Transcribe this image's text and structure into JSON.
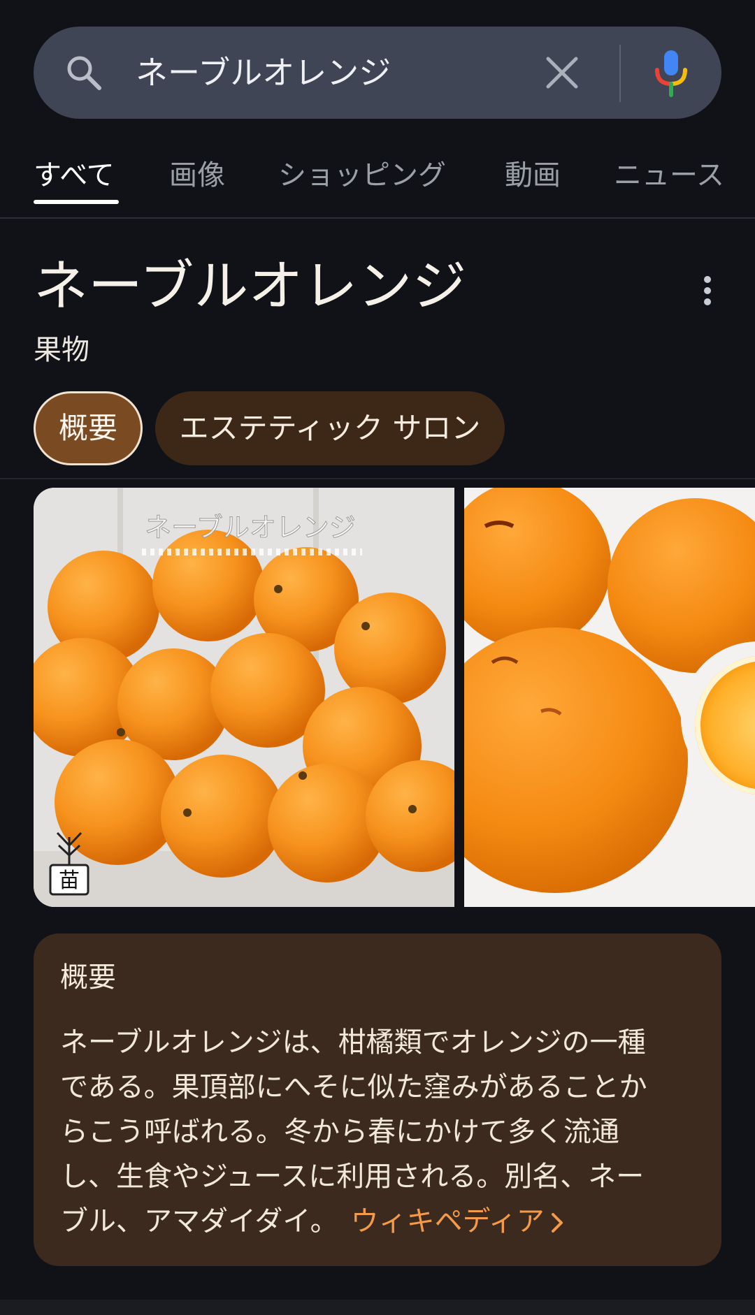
{
  "search": {
    "query": "ネーブルオレンジ"
  },
  "tabs": [
    {
      "label": "すべて",
      "active": true
    },
    {
      "label": "画像",
      "active": false
    },
    {
      "label": "ショッピング",
      "active": false
    },
    {
      "label": "動画",
      "active": false
    },
    {
      "label": "ニュース",
      "active": false
    }
  ],
  "knowledge_panel": {
    "title": "ネーブルオレンジ",
    "subtitle": "果物",
    "chips": [
      {
        "label": "概要",
        "selected": true
      },
      {
        "label": "エステティック サロン",
        "selected": false
      }
    ],
    "images": [
      {
        "overlay_text": "ネーブルオレンジ",
        "badge": "苗"
      },
      {
        "overlay_text": ""
      }
    ],
    "description": {
      "heading": "概要",
      "lines": [
        "ネーブルオレンジは、柑橘類でオレンジの一種",
        "である。果頂部にへそに似た窪みがあることか",
        "らこう呼ばれる。冬から春にかけて多く流通",
        "し、生食やジュースに利用される。別名、ネー",
        "ブル、アマダイダイ。"
      ],
      "source_link": "ウィキペディア"
    }
  },
  "colors": {
    "background": "#101218",
    "search_bar": "#3f4555",
    "chip_selected": "#7a4a23",
    "chip_unselected": "#3d2818",
    "card": "#3b2a1d",
    "link": "#f59a4a",
    "mic_blue": "#4285f4",
    "mic_red": "#ea4335",
    "mic_yellow": "#fbbc04",
    "mic_green": "#34a853"
  },
  "icons": [
    "search-icon",
    "clear-icon",
    "mic-icon",
    "more-vert-icon",
    "chevron-right-icon"
  ]
}
